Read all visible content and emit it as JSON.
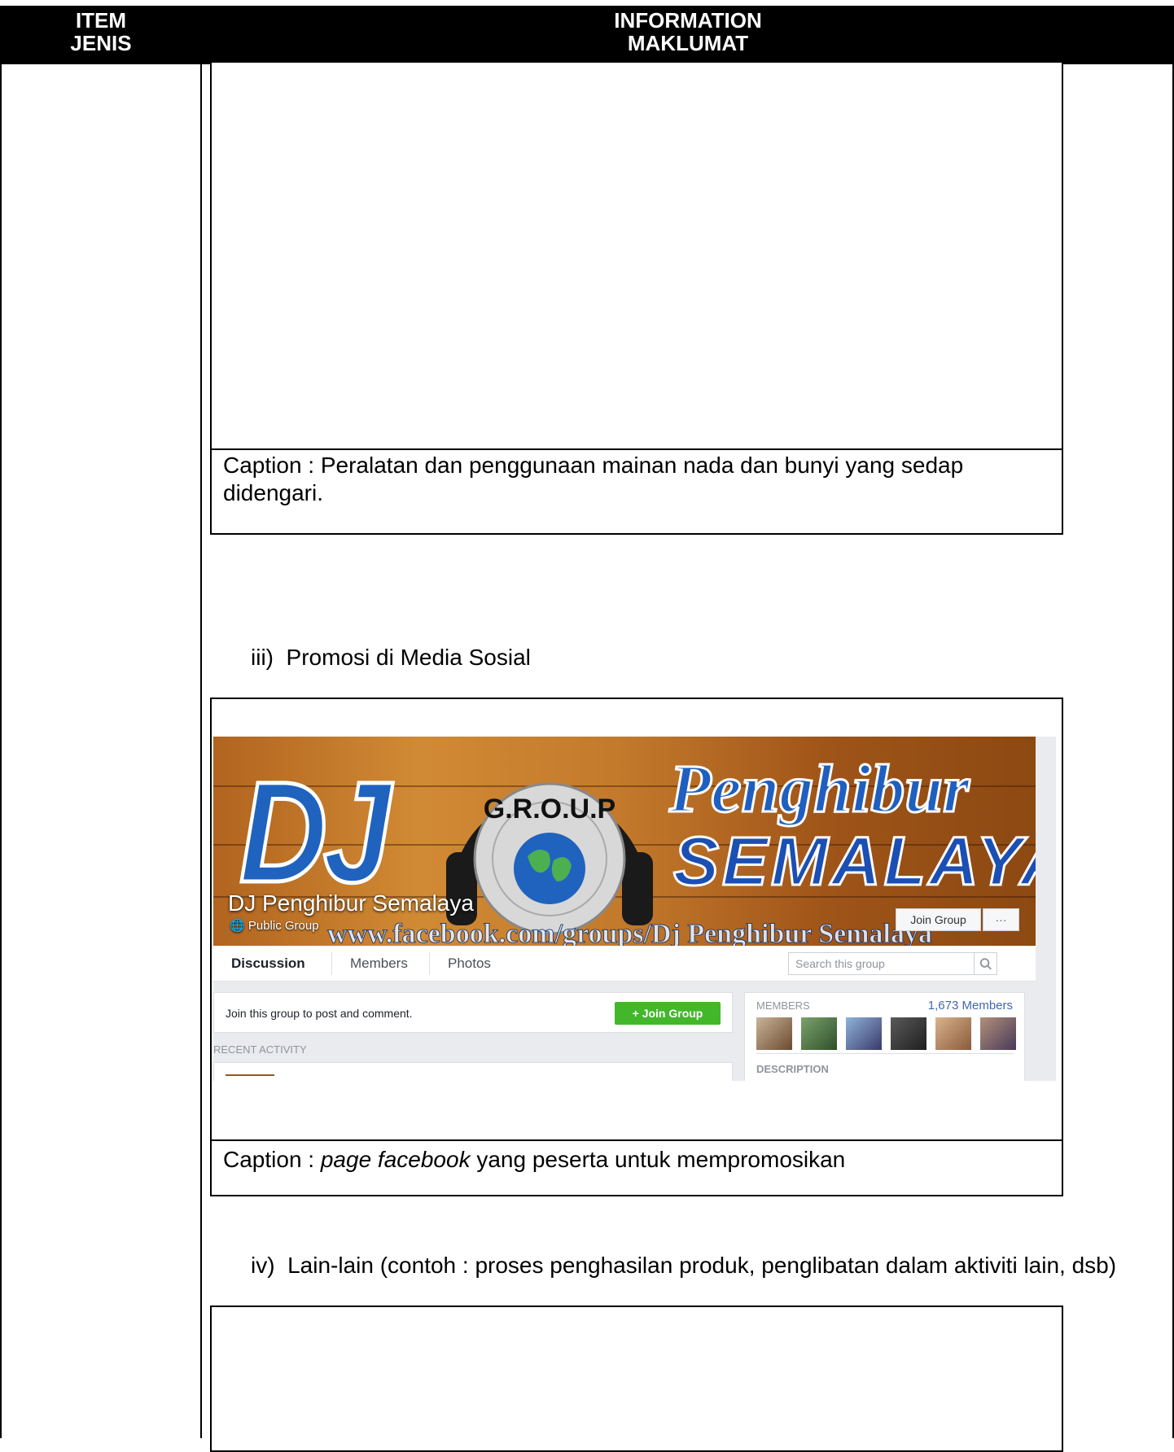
{
  "table_header": {
    "item_en": "ITEM",
    "item_ms": "JENIS",
    "info_en": "INFORMATION",
    "info_ms": "MAKLUMAT"
  },
  "section_ii": {
    "caption": "Caption : Peralatan dan penggunaan mainan nada dan bunyi yang sedap didengari."
  },
  "section_iii": {
    "label": "iii)  Promosi di Media Sosial",
    "caption_prefix": "Caption : ",
    "caption_italic": "page facebook",
    "caption_suffix": " yang peserta untuk mempromosikan",
    "facebook": {
      "cover_word_1": "DJ",
      "cover_logo_text": "G.R.O.U.P",
      "cover_word_2": "Penghibur",
      "cover_word_3": "SEMALAYA",
      "group_name": "DJ Penghibur Semalaya",
      "group_type": "Public Group",
      "watermark_url": "www.facebook.com/groups/Dj Penghibur Semalaya",
      "join_button_top": "Join Group",
      "more_button": "···",
      "tabs": [
        "Discussion",
        "Members",
        "Photos"
      ],
      "search_placeholder": "Search this group",
      "join_prompt": "Join this group to post and comment.",
      "join_button": "+ Join Group",
      "recent_activity": "RECENT ACTIVITY",
      "members_label": "MEMBERS",
      "members_count": "1,673 Members",
      "description_label": "DESCRIPTION"
    }
  },
  "section_iv": {
    "label": "iv)  Lain-lain (contoh : proses penghasilan produk, penglibatan dalam aktiviti lain, dsb)"
  },
  "colors": {
    "header_bg": "#000000",
    "fb_blue": "#4267b2",
    "fb_green": "#42b72a",
    "cover_wood": "#c3792b",
    "logo_blue": "#1f63bf"
  }
}
